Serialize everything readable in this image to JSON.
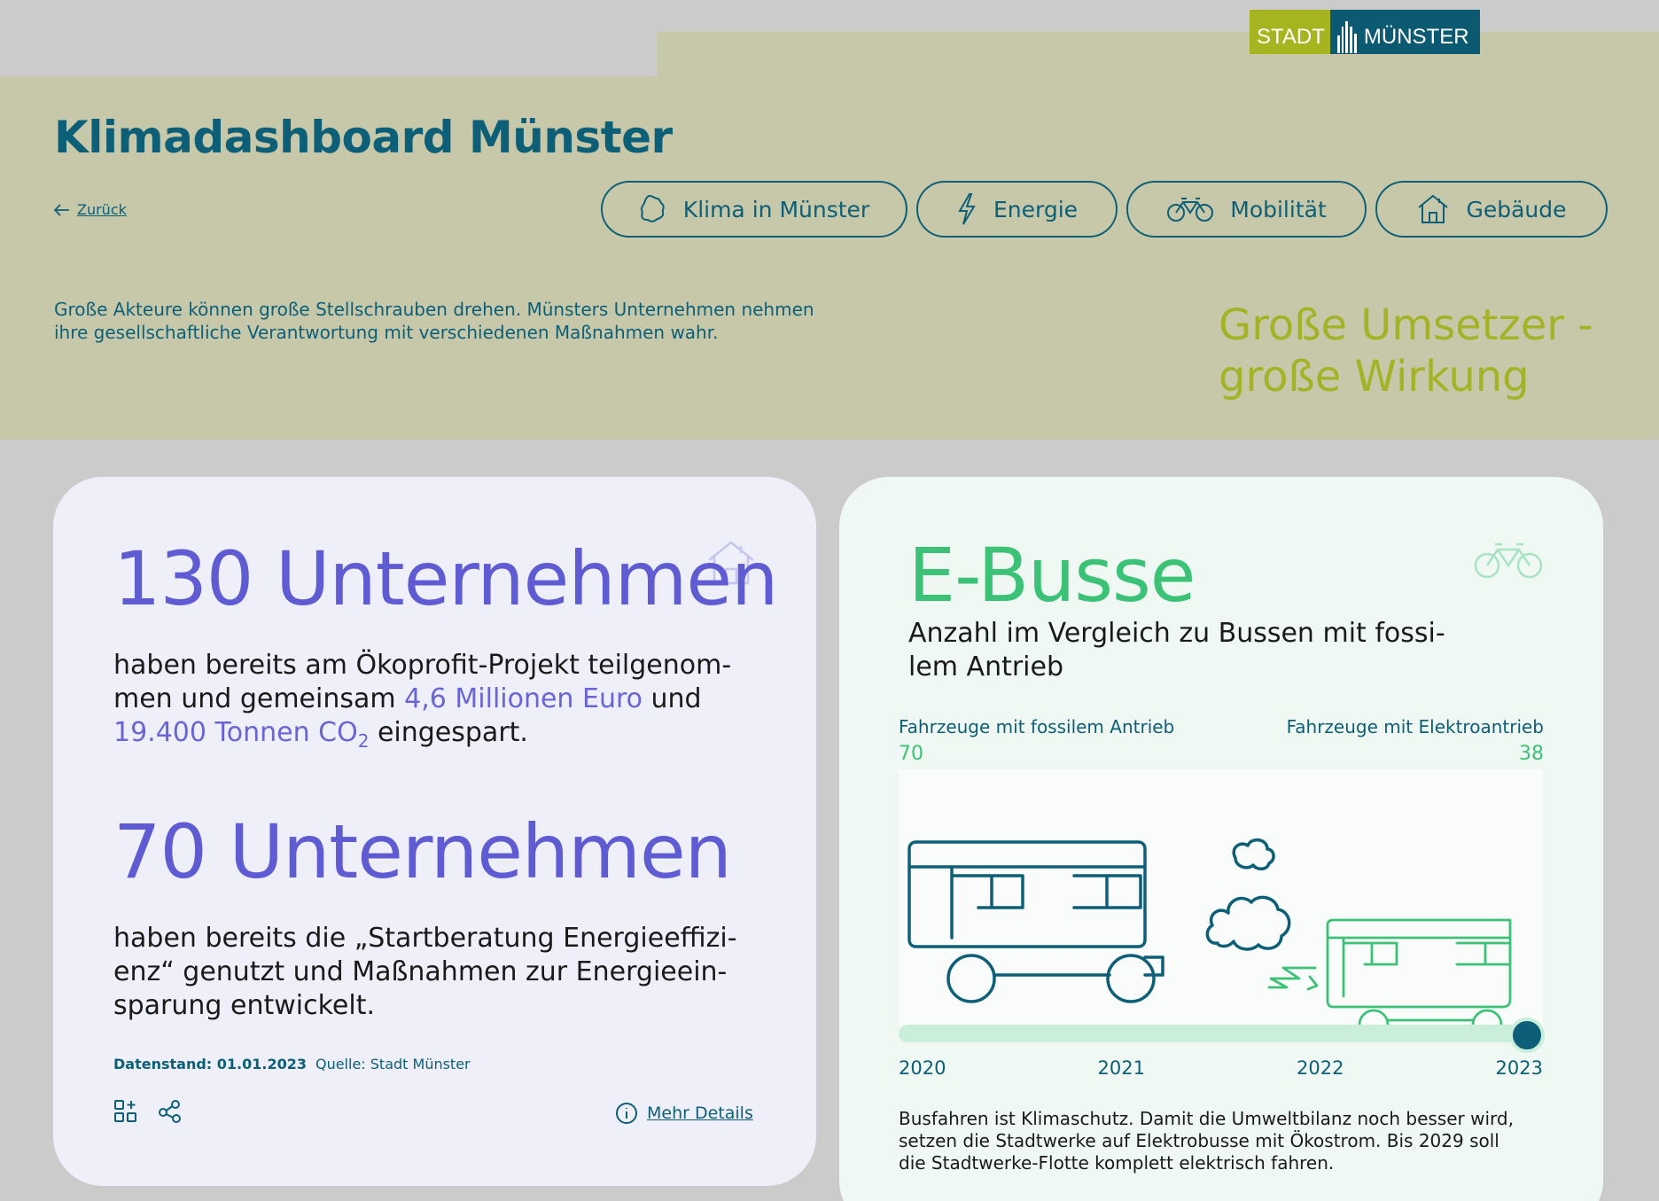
{
  "logo": {
    "left": "STADT",
    "right": "MÜNSTER"
  },
  "header": {
    "title": "Klimadashboard Münster",
    "back": "Zurück",
    "intro": "Große Akteure können große Stellschrauben drehen. Münsters Unternehmen nehmen ihre gesellschaftliche Verantwortung mit verschiedenen Maßnahmen wahr.",
    "slogan_line1": "Große Umsetzer -",
    "slogan_line2": "große Wirkung"
  },
  "nav": [
    {
      "label": "Klima in Münster",
      "icon": "map-icon"
    },
    {
      "label": "Energie",
      "icon": "lightning-icon"
    },
    {
      "label": "Mobilität",
      "icon": "bicycle-icon"
    },
    {
      "label": "Gebäude",
      "icon": "house-icon"
    }
  ],
  "left_card": {
    "stat1": "130 Unternehmen",
    "text1_a": "haben bereits am Ökoprofit-Projekt teilgenom-",
    "text1_b": "men und gemeinsam ",
    "text1_hl1": "4,6 Millionen Euro",
    "text1_c": " und",
    "text1_hl2": "19.400 Tonnen CO",
    "text1_hl2_sub": "2",
    "text1_d": " eingespart.",
    "stat2": "70 Unternehmen",
    "text2_a": "haben bereits die „Startberatung Energieeffizi-",
    "text2_b": "enz“ genutzt und Maßnahmen zur Energieein-",
    "text2_c": "sparung entwickelt.",
    "meta_label": "Datenstand: 01.01.2023",
    "meta_source": "Quelle: Stadt Münster",
    "more": "Mehr Details"
  },
  "right_card": {
    "title": "E-Busse",
    "subtitle_a": "Anzahl im Vergleich zu Bussen mit fossi-",
    "subtitle_b": "lem Antrieb",
    "legend_left": "Fahrzeuge mit fossilem Antrieb",
    "legend_left_value": "70",
    "legend_right": "Fahrzeuge mit Elektroantrieb",
    "legend_right_value": "38",
    "years": [
      "2020",
      "2021",
      "2022",
      "2023"
    ],
    "selected_year": "2023",
    "description": "Busfahren ist Klimaschutz. Damit die Umweltbilanz noch besser wird, setzen die Stadtwerke auf Elektrobusse mit Ökostrom. Bis 2029 soll die Stadtwerke-Flotte komplett elektrisch fahren."
  },
  "colors": {
    "petrol": "#0d5f78",
    "olive": "#c6c8a9",
    "lime": "#a4b325",
    "violet": "#5f5bd3",
    "green": "#3cc277"
  }
}
